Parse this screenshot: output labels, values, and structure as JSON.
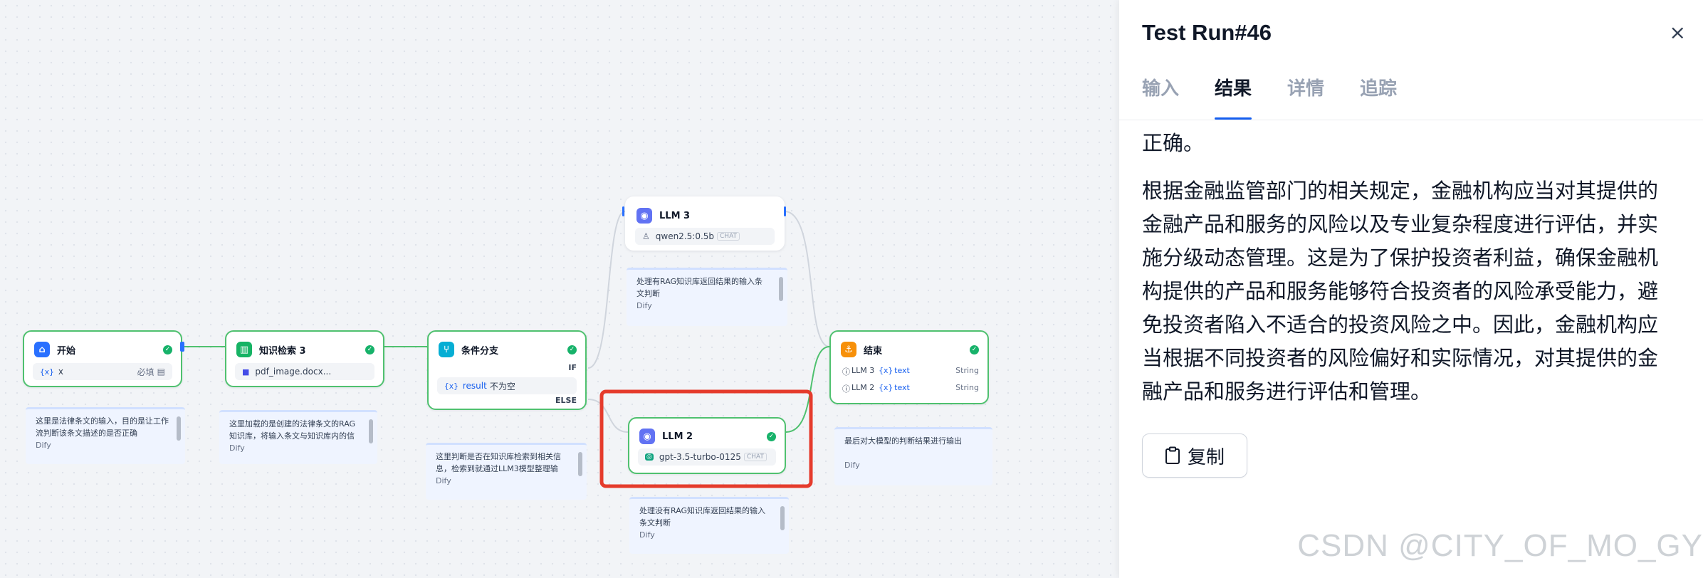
{
  "canvas": {
    "nodes": {
      "start": {
        "title": "开始",
        "var": "{x}",
        "var_name": "x",
        "required": "必填"
      },
      "knowledge": {
        "title": "知识检索 3",
        "file": "pdf_image.docx..."
      },
      "condition": {
        "title": "条件分支",
        "if_label": "IF",
        "var": "{x}",
        "var_name": "result",
        "op": "不为空",
        "else_label": "ELSE"
      },
      "llm3": {
        "title": "LLM 3",
        "model": "qwen2.5:0.5b",
        "badge": "CHAT"
      },
      "llm2": {
        "title": "LLM 2",
        "model": "gpt-3.5-turbo-0125",
        "badge": "CHAT"
      },
      "end": {
        "title": "结束",
        "outputs": [
          {
            "node": "LLM 3",
            "var": "{x}",
            "name": "text",
            "type": "String"
          },
          {
            "node": "LLM 2",
            "var": "{x}",
            "name": "text",
            "type": "String"
          }
        ]
      }
    },
    "notes": {
      "start": {
        "text": "这里是法律条文的输入，目的是让工作流判断该条文描述的是否正确",
        "src": "Dify"
      },
      "knowledge": {
        "text": "这里加载的是创建的法律条文的RAG知识库，将输入条文与知识库内的信",
        "src": "Dify"
      },
      "condition": {
        "text": "这里判断是否在知识库检索到相关信息，检索到就通过LLM3模型整理输",
        "src": "Dify"
      },
      "llm3": {
        "text": "处理有RAG知识库返回结果的输入条文判断",
        "src": "Dify"
      },
      "llm2": {
        "text": "处理没有RAG知识库返回结果的输入条文判断",
        "src": "Dify"
      },
      "end": {
        "text": "最后对大模型的判断结果进行输出",
        "src": "Dify"
      }
    }
  },
  "panel": {
    "title": "Test Run#46",
    "close_icon": "×",
    "tabs": [
      "输入",
      "结果",
      "详情",
      "追踪"
    ],
    "active_tab": "结果",
    "result_paragraphs": [
      "正确。",
      "根据金融监管部门的相关规定，金融机构应当对其提供的金融产品和服务的风险以及专业复杂程度进行评估，并实施分级动态管理。这是为了保护投资者利益，确保金融机构提供的产品和服务能够符合投资者的风险承受能力，避免投资者陷入不适合的投资风险之中。因此，金融机构应当根据不同投资者的风险偏好和实际情况，对其提供的金融产品和服务进行评估和管理。"
    ],
    "copy_label": "复制"
  },
  "watermark": "CSDN @CITY_OF_MO_GY",
  "colors": {
    "accent": "#155eef",
    "success": "#17b26a",
    "highlight": "#e53b2c",
    "edge": "#4fc16f"
  }
}
